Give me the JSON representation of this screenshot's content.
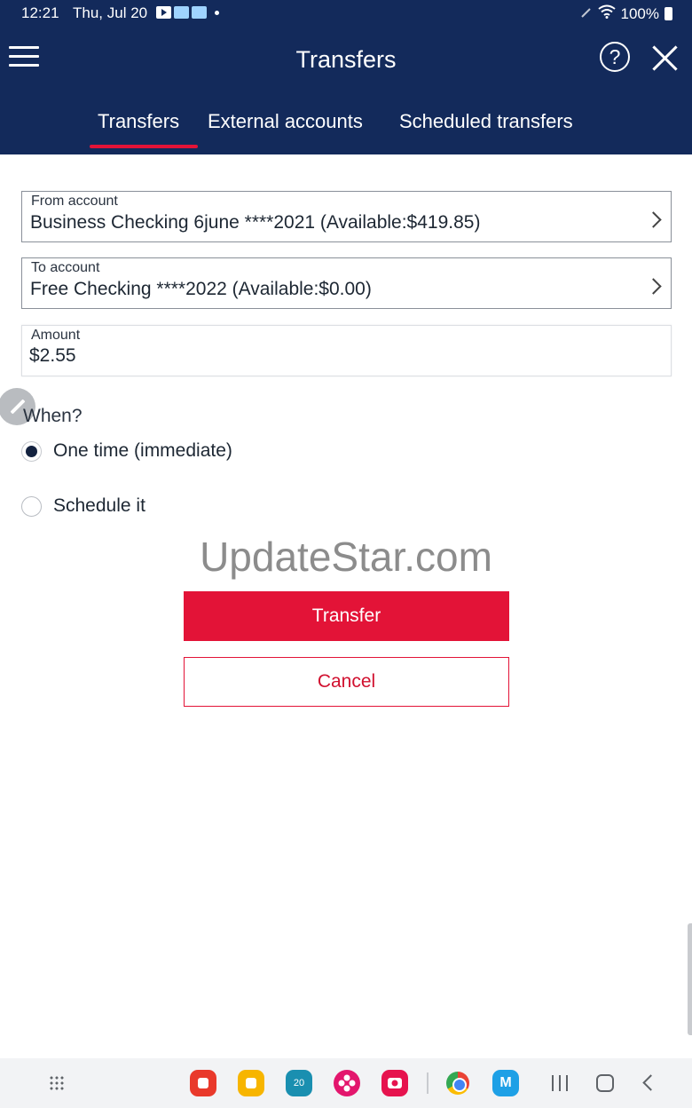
{
  "status_bar": {
    "time": "12:21",
    "date": "Thu, Jul 20",
    "battery": "100%",
    "icons": [
      "youtube-icon",
      "app-notification-icon",
      "app-notification-icon",
      "dot-icon",
      "pen-icon",
      "wifi-icon",
      "battery-icon"
    ]
  },
  "header": {
    "title": "Transfers",
    "icons": [
      "menu-icon",
      "help-icon",
      "close-icon"
    ],
    "help_glyph": "?",
    "background_color": "#132a5b"
  },
  "tabs": [
    {
      "label": "Transfers",
      "active": true
    },
    {
      "label": "External accounts",
      "active": false
    },
    {
      "label": "Scheduled transfers",
      "active": false
    }
  ],
  "form": {
    "from_account": {
      "label": "From account",
      "value": "Business Checking 6june ****2021 (Available:$419.85)"
    },
    "to_account": {
      "label": "To account",
      "value": "Free Checking ****2022 (Available:$0.00)"
    },
    "amount": {
      "label": "Amount",
      "value": "$2.55"
    },
    "when": {
      "label": "When?",
      "options": [
        {
          "label": "One time (immediate)",
          "selected": true
        },
        {
          "label": "Schedule it",
          "selected": false
        }
      ]
    }
  },
  "watermark": "UpdateStar.com",
  "actions": {
    "transfer_label": "Transfer",
    "cancel_label": "Cancel",
    "accent_color": "#e31337"
  },
  "taskbar": {
    "apps": [
      "app-grid-icon",
      "notes-app-icon",
      "files-app-icon",
      "calendar-app-icon",
      "flower-app-icon",
      "camera-app-icon",
      "chrome-icon",
      "gmail-icon"
    ],
    "calendar_day": "20",
    "gmail_glyph": "M",
    "nav": [
      "recents-icon",
      "home-icon",
      "back-icon"
    ]
  }
}
